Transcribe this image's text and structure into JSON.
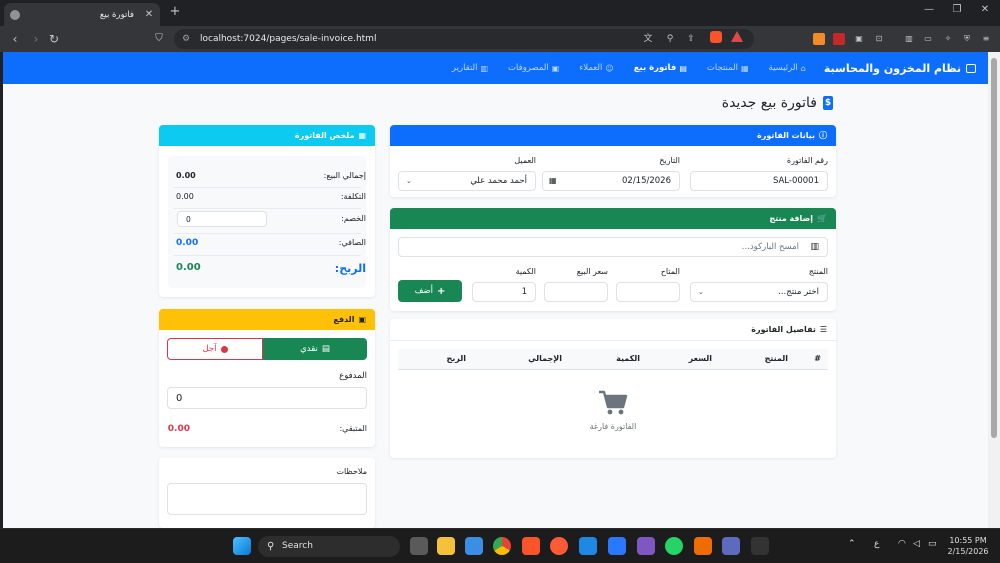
{
  "browser": {
    "tab_title": "فاتورة بيع",
    "url": "localhost:7024/pages/sale-invoice.html"
  },
  "nav": {
    "brand": "نظام المخزون والمحاسبة",
    "links": [
      "الرئيسية",
      "المنتجات",
      "فاتورة بيع",
      "العملاء",
      "المصروفات",
      "التقارير"
    ]
  },
  "page": {
    "title": "فاتورة بيع جديدة"
  },
  "invoice": {
    "header": "بيانات الفاتورة",
    "number_label": "رقم الفاتورة",
    "number_value": "SAL-00001",
    "date_label": "التاريخ",
    "date_value": "02/15/2026",
    "customer_label": "العميل",
    "customer_value": "أحمد محمد علي"
  },
  "add_product": {
    "header": "إضافة منتج",
    "barcode_placeholder": "امسح الباركود...",
    "product_label": "المنتج",
    "product_placeholder": "اختر منتج...",
    "available_label": "المتاح",
    "price_label": "سعر البيع",
    "qty_label": "الكمية",
    "qty_value": "1",
    "add_button": "أضف"
  },
  "details": {
    "header": "تفاصيل الفاتورة",
    "columns": [
      "#",
      "المنتج",
      "السعر",
      "الكمية",
      "الإجمالي",
      "الربح"
    ],
    "empty_text": "الفاتورة فارغة"
  },
  "summary": {
    "header": "ملخص الفاتورة",
    "total_sale_label": "إجمالي البيع:",
    "total_sale_value": "0.00",
    "cost_label": "التكلفة:",
    "cost_value": "0.00",
    "discount_label": "الخصم:",
    "discount_value": "0",
    "net_label": "الصافي:",
    "net_value": "0.00",
    "profit_label": "الربح:",
    "profit_value": "0.00"
  },
  "payment": {
    "header": "الدفع",
    "cash_label": "نقدي",
    "credit_label": "آجل",
    "paid_label": "المدفوع",
    "paid_value": "0",
    "remaining_label": "المتبقي:",
    "remaining_value": "0.00"
  },
  "notes": {
    "label": "ملاحظات"
  },
  "taskbar": {
    "search": "Search",
    "time": "10:55 PM",
    "date": "2/15/2026",
    "lang": "ع"
  },
  "colors": {
    "primary": "#0d6efd",
    "success": "#198754",
    "info": "#0dcaf0",
    "warning": "#ffc107",
    "danger": "#dc3545"
  }
}
